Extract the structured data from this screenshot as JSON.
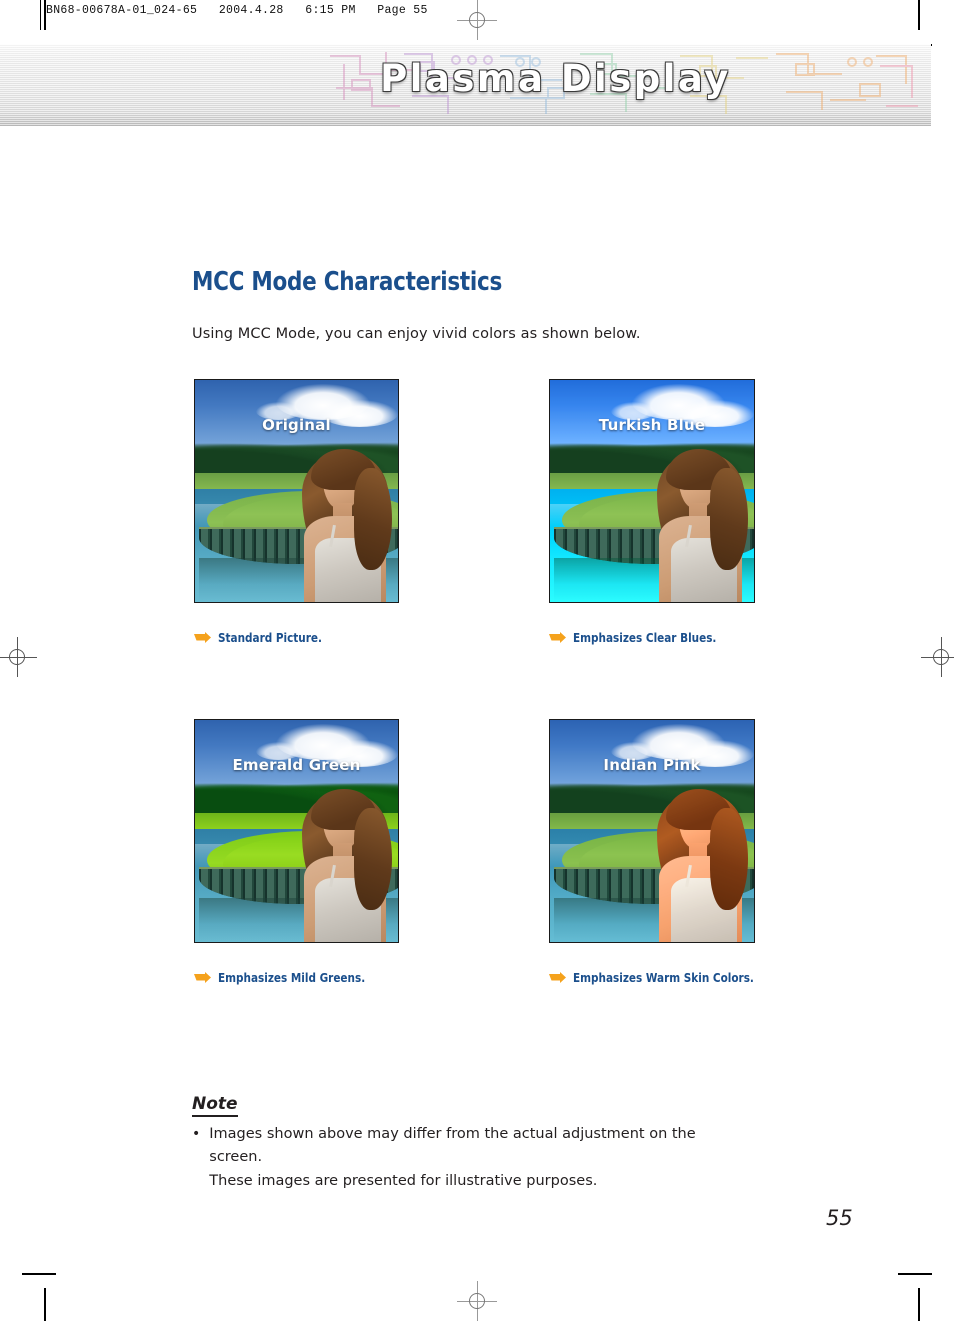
{
  "print_slug": "BN68-00678A-01_024-65   2004.4.28   6:15 PM   Page 55",
  "banner": {
    "title": "Plasma Display"
  },
  "page": {
    "title": "MCC Mode Characteristics",
    "intro": "Using MCC Mode, you can enjoy vivid colors as shown below.",
    "number": "55"
  },
  "colors": {
    "heading_blue": "#1b4f8c",
    "caption_blue": "#1b4f8c",
    "arrow_orange": "#f5a21c",
    "body_black": "#231f20"
  },
  "samples": [
    {
      "label": "Original",
      "caption": "Standard Picture.",
      "arrow_icon": "arrow-right-icon"
    },
    {
      "label": "Turkish Blue",
      "caption": "Emphasizes Clear Blues.",
      "arrow_icon": "arrow-right-icon"
    },
    {
      "label": "Emerald Green",
      "caption": "Emphasizes Mild Greens.",
      "arrow_icon": "arrow-right-icon"
    },
    {
      "label": "Indian Pink",
      "caption": "Emphasizes Warm Skin Colors.",
      "arrow_icon": "arrow-right-icon"
    }
  ],
  "note": {
    "title": "Note",
    "bullet": "•",
    "line1": "Images shown above may differ from the actual adjustment on the screen.",
    "line2": "These images are presented for illustrative purposes."
  }
}
